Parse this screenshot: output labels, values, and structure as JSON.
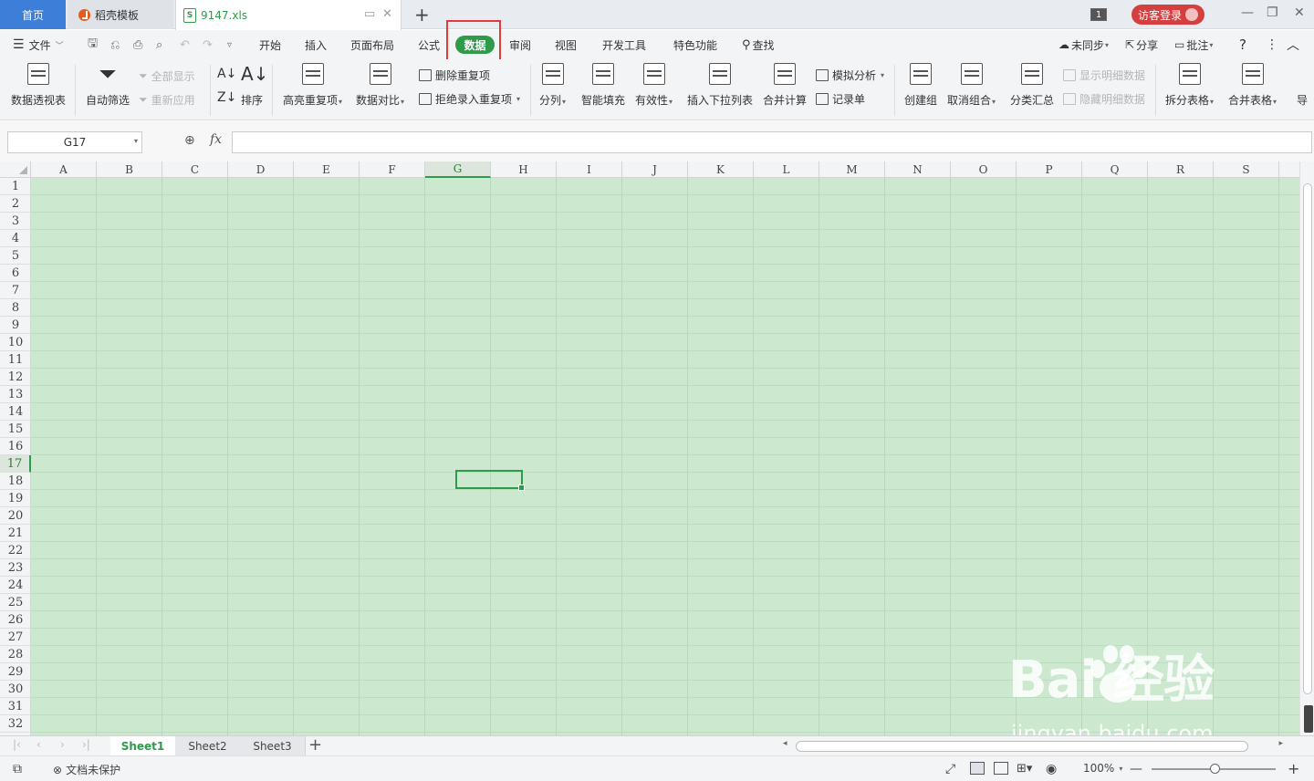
{
  "tabs": {
    "home": "首页",
    "template": "稻壳模板",
    "file": "9147.xls",
    "file_icon": "S",
    "window_count": "1",
    "login": "访客登录"
  },
  "menu": {
    "file": "文件",
    "items": [
      "开始",
      "插入",
      "页面布局",
      "公式",
      "数据",
      "审阅",
      "视图",
      "开发工具",
      "特色功能"
    ],
    "active": "数据",
    "find": "查找",
    "sync": "未同步",
    "share": "分享",
    "comment": "批注"
  },
  "ribbon": {
    "pivot": "数据透视表",
    "autofilter": "自动筛选",
    "show_all": "全部显示",
    "reapply": "重新应用",
    "sort": "排序",
    "highlight_dup": "高亮重复项",
    "compare": "数据对比",
    "remove_dup": "删除重复项",
    "reject_dup": "拒绝录入重复项",
    "split": "分列",
    "smart_fill": "智能填充",
    "validity": "有效性",
    "insert_dropdown": "插入下拉列表",
    "consolidate": "合并计算",
    "whatif": "模拟分析",
    "record": "记录单",
    "group": "创建组",
    "ungroup": "取消组合",
    "subtotal": "分类汇总",
    "show_detail": "显示明细数据",
    "hide_detail": "隐藏明细数据",
    "split_table": "拆分表格",
    "merge_table": "合并表格",
    "more": "导"
  },
  "formula": {
    "cell_ref": "G17",
    "fx": "fx",
    "value": ""
  },
  "grid": {
    "columns": [
      "A",
      "B",
      "C",
      "D",
      "E",
      "F",
      "G",
      "H",
      "I",
      "J",
      "K",
      "L",
      "M",
      "N",
      "O",
      "P",
      "Q",
      "R",
      "S"
    ],
    "rows": [
      "1",
      "2",
      "3",
      "4",
      "5",
      "6",
      "7",
      "8",
      "9",
      "10",
      "11",
      "12",
      "13",
      "14",
      "15",
      "16",
      "17",
      "18",
      "19",
      "20",
      "21",
      "22",
      "23",
      "24",
      "25",
      "26",
      "27",
      "28",
      "29",
      "30",
      "31",
      "32"
    ],
    "selected_col": "G",
    "selected_row": "17",
    "eye_protection_color": "#cce8cf"
  },
  "sheets": [
    "Sheet1",
    "Sheet2",
    "Sheet3"
  ],
  "active_sheet": "Sheet1",
  "status": {
    "protect": "文档未保护",
    "zoom": "100%"
  },
  "watermark": {
    "logo": "Bai  经验",
    "url": "jingyan.baidu.com"
  },
  "accent": "#2e9b4a",
  "highlight_box": "#e03c3c"
}
